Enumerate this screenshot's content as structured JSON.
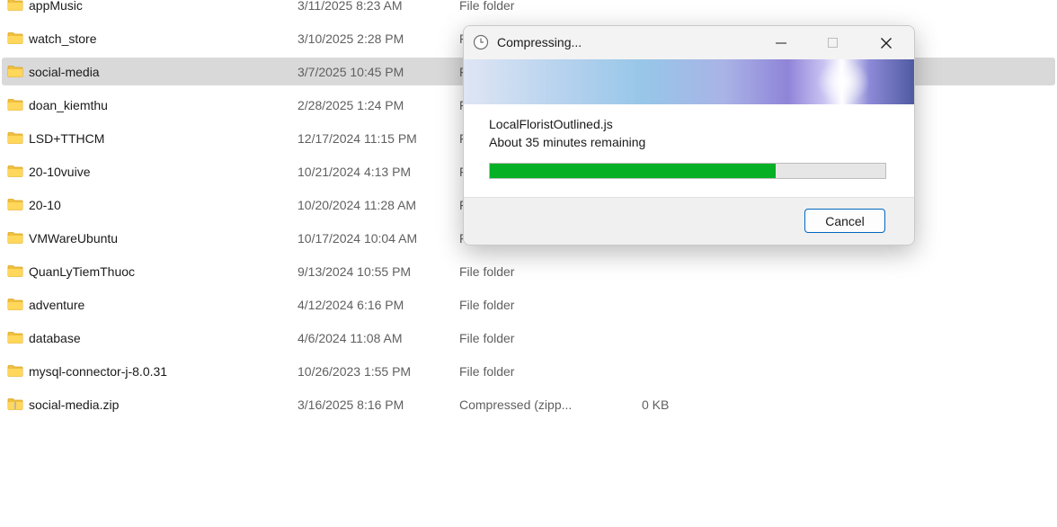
{
  "explorer": {
    "rows": [
      {
        "name": "appMusic",
        "date": "3/11/2025 8:23 AM",
        "type": "File folder",
        "size": "",
        "icon": "folder-icon",
        "selected": false
      },
      {
        "name": "watch_store",
        "date": "3/10/2025 2:28 PM",
        "type": "File folder",
        "size": "",
        "icon": "folder-icon",
        "selected": false
      },
      {
        "name": "social-media",
        "date": "3/7/2025 10:45 PM",
        "type": "File folder",
        "size": "",
        "icon": "folder-icon",
        "selected": true
      },
      {
        "name": "doan_kiemthu",
        "date": "2/28/2025 1:24 PM",
        "type": "File folder",
        "size": "",
        "icon": "folder-icon",
        "selected": false
      },
      {
        "name": "LSD+TTHCM",
        "date": "12/17/2024 11:15 PM",
        "type": "File folder",
        "size": "",
        "icon": "folder-icon",
        "selected": false
      },
      {
        "name": "20-10vuive",
        "date": "10/21/2024 4:13 PM",
        "type": "File folder",
        "size": "",
        "icon": "folder-icon",
        "selected": false
      },
      {
        "name": "20-10",
        "date": "10/20/2024 11:28 AM",
        "type": "File folder",
        "size": "",
        "icon": "folder-icon",
        "selected": false
      },
      {
        "name": "VMWareUbuntu",
        "date": "10/17/2024 10:04 AM",
        "type": "File folder",
        "size": "",
        "icon": "folder-icon",
        "selected": false
      },
      {
        "name": "QuanLyTiemThuoc",
        "date": "9/13/2024 10:55 PM",
        "type": "File folder",
        "size": "",
        "icon": "folder-icon",
        "selected": false
      },
      {
        "name": "adventure",
        "date": "4/12/2024 6:16 PM",
        "type": "File folder",
        "size": "",
        "icon": "folder-icon",
        "selected": false
      },
      {
        "name": "database",
        "date": "4/6/2024 11:08 AM",
        "type": "File folder",
        "size": "",
        "icon": "folder-icon",
        "selected": false
      },
      {
        "name": "mysql-connector-j-8.0.31",
        "date": "10/26/2023 1:55 PM",
        "type": "File folder",
        "size": "",
        "icon": "folder-icon",
        "selected": false
      },
      {
        "name": "social-media.zip",
        "date": "3/16/2025 8:16 PM",
        "type": "Compressed (zipp...",
        "size": "0 KB",
        "icon": "zip-folder-icon",
        "selected": false
      }
    ]
  },
  "dialog": {
    "title": "Compressing...",
    "title_icon": "clock-icon",
    "file_name": "LocalFloristOutlined.js",
    "time_remaining": "About 35 minutes remaining",
    "progress": 0.723,
    "progress_color": "#06b025",
    "cancel_label": "Cancel",
    "buttons": {
      "minimize": "minimize-icon",
      "maximize": "maximize-icon",
      "close": "close-icon"
    }
  }
}
